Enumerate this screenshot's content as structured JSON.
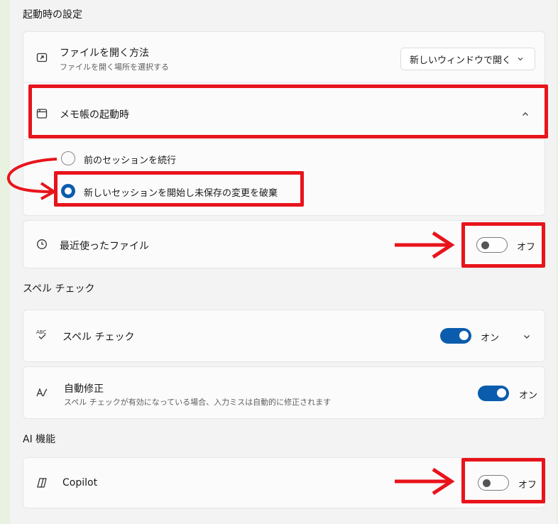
{
  "startup": {
    "section_title": "起動時の設定",
    "open_files": {
      "label": "ファイルを開く方法",
      "description": "ファイルを開く場所を選択する",
      "dropdown_value": "新しいウィンドウで開く"
    },
    "notepad_startup": {
      "label": "メモ帳の起動時",
      "options": [
        {
          "label": "前のセッションを続行",
          "selected": false
        },
        {
          "label": "新しいセッションを開始し未保存の変更を破棄",
          "selected": true
        }
      ]
    },
    "recent_files": {
      "label": "最近使ったファイル",
      "state": "オフ"
    }
  },
  "spellcheck": {
    "section_title": "スペル チェック",
    "spell_check": {
      "label": "スペル チェック",
      "icon_text": "ABC",
      "state": "オン"
    },
    "autocorrect": {
      "label": "自動修正",
      "description": "スペル チェックが有効になっている場合、入力ミスは自動的に修正されます",
      "state": "オン"
    }
  },
  "ai": {
    "section_title": "AI 機能",
    "copilot": {
      "label": "Copilot",
      "state": "オフ"
    }
  },
  "colors": {
    "accent": "#0b5cad",
    "annotation": "#e8141b"
  }
}
